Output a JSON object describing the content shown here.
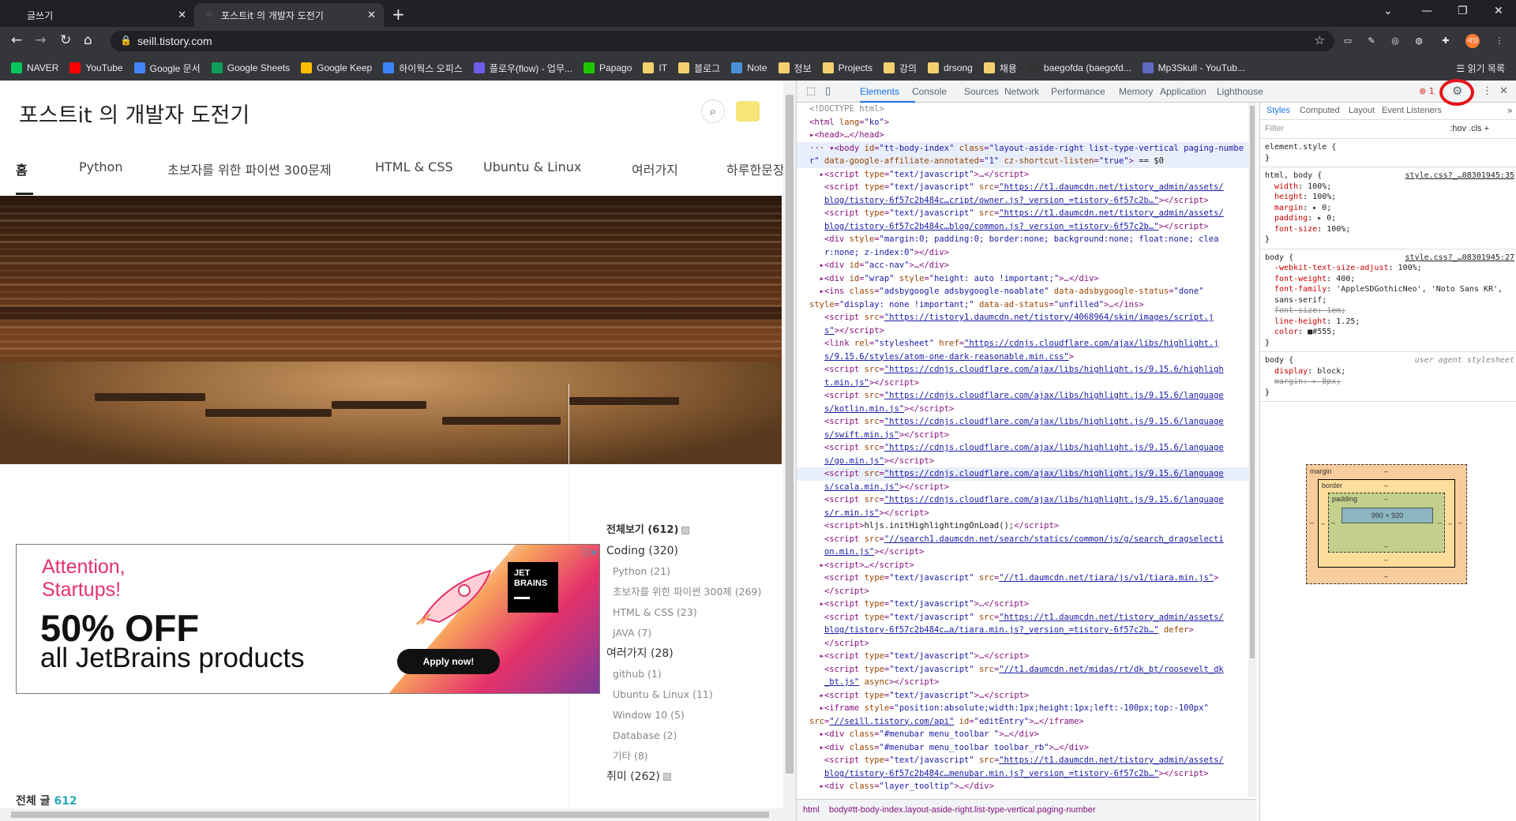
{
  "browser": {
    "tabs": [
      {
        "label": "글쓰기",
        "active": false
      },
      {
        "label": "포스트it 의 개발자 도전기",
        "active": true
      }
    ],
    "url": "seill.tistory.com",
    "profile_badge": "세일",
    "bookmarks": [
      {
        "label": "NAVER",
        "color": "#03c75a",
        "icon": "naver-icon"
      },
      {
        "label": "YouTube",
        "color": "#ff0000",
        "icon": "youtube-icon"
      },
      {
        "label": "Google 문서",
        "color": "#4285f4",
        "icon": "docs-icon"
      },
      {
        "label": "Google Sheets",
        "color": "#0f9d58",
        "icon": "sheets-icon"
      },
      {
        "label": "Google Keep",
        "color": "#fbbc04",
        "icon": "keep-icon"
      },
      {
        "label": "하이웍스 오피스",
        "color": "#3b82f6",
        "icon": "hiworks-icon"
      },
      {
        "label": "플로우(flow) - 업무...",
        "color": "#6c5ce7",
        "icon": "flow-icon"
      },
      {
        "label": "Papago",
        "color": "#1ec800",
        "icon": "papago-icon"
      },
      {
        "label": "IT",
        "color": "#f4d06f",
        "icon": "folder-icon"
      },
      {
        "label": "블로그",
        "color": "#f4d06f",
        "icon": "folder-icon"
      },
      {
        "label": "Note",
        "color": "#4a90d9",
        "icon": "note-icon"
      },
      {
        "label": "정보",
        "color": "#f4d06f",
        "icon": "folder-icon"
      },
      {
        "label": "Projects",
        "color": "#f4d06f",
        "icon": "folder-icon"
      },
      {
        "label": "강의",
        "color": "#f4d06f",
        "icon": "folder-icon"
      },
      {
        "label": "drsong",
        "color": "#f4d06f",
        "icon": "folder-icon"
      },
      {
        "label": "채용",
        "color": "#f4d06f",
        "icon": "folder-icon"
      },
      {
        "label": "baegofda (baegofd...",
        "color": "#333333",
        "icon": "github-icon"
      },
      {
        "label": "Mp3Skull - YouTub...",
        "color": "#5c6bc0",
        "icon": "mp3skull-icon"
      }
    ],
    "reading_list": "읽기 목록"
  },
  "blog": {
    "title": "포스트it 의 개발자 도전기",
    "menu": [
      "홈",
      "Python",
      "초보자를 위한 파이썬 300문제",
      "HTML & CSS",
      "Ubuntu & Linux",
      "여러가지",
      "하루한문장"
    ],
    "ad": {
      "line1": "Attention,",
      "line2": "Startups!",
      "headline": "50% OFF",
      "subline": "all JetBrains products",
      "button": "Apply now!",
      "logo_line1": "JET",
      "logo_line2": "BRAINS"
    },
    "categories": [
      {
        "label": "전체보기 (612)",
        "level": "main",
        "new": true
      },
      {
        "label": "Coding (320)",
        "level": "group",
        "new": false
      },
      {
        "label": "Python (21)",
        "level": "sub",
        "new": false
      },
      {
        "label": "초보자를 위한 파이썬 300제 (269)",
        "level": "sub",
        "new": false
      },
      {
        "label": "HTML & CSS (23)",
        "level": "sub",
        "new": false
      },
      {
        "label": "JAVA (7)",
        "level": "sub",
        "new": false
      },
      {
        "label": "여러가지 (28)",
        "level": "group",
        "new": false
      },
      {
        "label": "github (1)",
        "level": "sub",
        "new": false
      },
      {
        "label": "Ubuntu & Linux (11)",
        "level": "sub",
        "new": false
      },
      {
        "label": "Window 10 (5)",
        "level": "sub",
        "new": false
      },
      {
        "label": "Database (2)",
        "level": "sub",
        "new": false
      },
      {
        "label": "기타 (8)",
        "level": "sub",
        "new": false
      },
      {
        "label": "취미 (262)",
        "level": "group",
        "new": true
      }
    ],
    "total_label": "전체 글",
    "total_count": "612"
  },
  "devtools": {
    "tabs": [
      "Elements",
      "Console",
      "Sources",
      "Network",
      "Performance",
      "Memory",
      "Application",
      "Lighthouse"
    ],
    "error_count": "1",
    "breadcrumb_html": "html",
    "breadcrumb_body": "body#tt-body-index.layout-aside-right.list-type-vertical.paging-number",
    "style_tabs": [
      "Styles",
      "Computed",
      "Layout",
      "Event Listeners"
    ],
    "filter_placeholder": "Filter",
    "filter_right": ":hov  .cls  +",
    "box_model": {
      "margin": "margin",
      "border": "border",
      "padding": "padding",
      "content": "990 × 920",
      "dash": "–"
    },
    "dom_lines": [
      {
        "cls": "doc",
        "html": "&lt;!DOCTYPE html&gt;"
      },
      {
        "cls": "",
        "html": "<span class='t'>&lt;html</span> <span class='an'>lang</span>=<span class='av'>\"ko\"</span><span class='t'>&gt;</span>"
      },
      {
        "cls": "",
        "html": "▸<span class='t'>&lt;head&gt;</span>…<span class='t'>&lt;/head&gt;</span>"
      },
      {
        "cls": "sel",
        "html": "··· ▾<span class='t'>&lt;body</span> <span class='an'>id</span>=<span class='av'>\"tt-body-index\"</span> <span class='an'>class</span>=<span class='av'>\"layout-aside-right list-type-vertical paging-numbe</span>"
      },
      {
        "cls": "sel",
        "html": "<span class='av'>r\"</span> <span class='an'>data-google-affiliate-annotated</span>=<span class='av'>\"1\"</span> <span class='an'>cz-shortcut-listen</span>=<span class='av'>\"true\"</span><span class='t'>&gt;</span> <span class='tx'>== $0</span>"
      },
      {
        "cls": "",
        "html": "&nbsp;&nbsp;▸<span class='t'>&lt;script</span> <span class='an'>type</span>=<span class='av'>\"text/javascript\"</span><span class='t'>&gt;</span>…<span class='t'>&lt;/script&gt;</span>"
      },
      {
        "cls": "",
        "html": "&nbsp;&nbsp;&nbsp;<span class='t'>&lt;script</span> <span class='an'>type</span>=<span class='av'>\"text/javascript\"</span> <span class='an'>src</span>=<span class='lnk'>\"https://t1.daumcdn.net/tistory_admin/assets/</span>"
      },
      {
        "cls": "",
        "html": "&nbsp;&nbsp;&nbsp;<span class='lnk'>blog/tistory-6f57c2b484c…cript/owner.js?_version_=tistory-6f57c2b…\"</span><span class='t'>&gt;&lt;/script&gt;</span>"
      },
      {
        "cls": "",
        "html": "&nbsp;&nbsp;&nbsp;<span class='t'>&lt;script</span> <span class='an'>type</span>=<span class='av'>\"text/javascript\"</span> <span class='an'>src</span>=<span class='lnk'>\"https://t1.daumcdn.net/tistory_admin/assets/</span>"
      },
      {
        "cls": "",
        "html": "&nbsp;&nbsp;&nbsp;<span class='lnk'>blog/tistory-6f57c2b484c…blog/common.js?_version_=tistory-6f57c2b…\"</span><span class='t'>&gt;&lt;/script&gt;</span>"
      },
      {
        "cls": "",
        "html": "&nbsp;&nbsp;&nbsp;<span class='t'>&lt;div</span> <span class='an'>style</span>=<span class='av'>\"margin:0; padding:0; border:none; background:none; float:none; clea</span>"
      },
      {
        "cls": "",
        "html": "&nbsp;&nbsp;&nbsp;<span class='av'>r:none; z-index:0\"</span><span class='t'>&gt;&lt;/div&gt;</span>"
      },
      {
        "cls": "",
        "html": "&nbsp;&nbsp;▸<span class='t'>&lt;div</span> <span class='an'>id</span>=<span class='av'>\"acc-nav\"</span><span class='t'>&gt;</span>…<span class='t'>&lt;/div&gt;</span>"
      },
      {
        "cls": "",
        "html": "&nbsp;&nbsp;▸<span class='t'>&lt;div</span> <span class='an'>id</span>=<span class='av'>\"wrap\"</span> <span class='an'>style</span>=<span class='av'>\"height: auto !important;\"</span><span class='t'>&gt;</span>…<span class='t'>&lt;/div&gt;</span>"
      },
      {
        "cls": "",
        "html": "&nbsp;&nbsp;▸<span class='t'>&lt;ins</span> <span class='an'>class</span>=<span class='av'>\"adsbygoogle adsbygoogle-noablate\"</span> <span class='an'>data-adsbygoogle-status</span>=<span class='av'>\"done\"</span>"
      },
      {
        "cls": "",
        "html": "<span class='an'>style</span>=<span class='av'>\"display: none !important;\"</span> <span class='an'>data-ad-status</span>=<span class='av'>\"unfilled\"</span><span class='t'>&gt;</span>…<span class='t'>&lt;/ins&gt;</span>"
      },
      {
        "cls": "",
        "html": "&nbsp;&nbsp;&nbsp;<span class='t'>&lt;script</span> <span class='an'>src</span>=<span class='lnk'>\"https://tistory1.daumcdn.net/tistory/4068964/skin/images/script.j</span>"
      },
      {
        "cls": "",
        "html": "&nbsp;&nbsp;&nbsp;<span class='lnk'>s\"</span><span class='t'>&gt;&lt;/script&gt;</span>"
      },
      {
        "cls": "",
        "html": "&nbsp;&nbsp;&nbsp;<span class='t'>&lt;link</span> <span class='an'>rel</span>=<span class='av'>\"stylesheet\"</span> <span class='an'>href</span>=<span class='lnk'>\"https://cdnjs.cloudflare.com/ajax/libs/highlight.j</span>"
      },
      {
        "cls": "",
        "html": "&nbsp;&nbsp;&nbsp;<span class='lnk'>s/9.15.6/styles/atom-one-dark-reasonable.min.css\"</span><span class='t'>&gt;</span>"
      },
      {
        "cls": "",
        "html": "&nbsp;&nbsp;&nbsp;<span class='t'>&lt;script</span> <span class='an'>src</span>=<span class='lnk'>\"https://cdnjs.cloudflare.com/ajax/libs/highlight.js/9.15.6/highligh</span>"
      },
      {
        "cls": "",
        "html": "&nbsp;&nbsp;&nbsp;<span class='lnk'>t.min.js\"</span><span class='t'>&gt;&lt;/script&gt;</span>"
      },
      {
        "cls": "",
        "html": "&nbsp;&nbsp;&nbsp;<span class='t'>&lt;script</span> <span class='an'>src</span>=<span class='lnk'>\"https://cdnjs.cloudflare.com/ajax/libs/highlight.js/9.15.6/language</span>"
      },
      {
        "cls": "",
        "html": "&nbsp;&nbsp;&nbsp;<span class='lnk'>s/kotlin.min.js\"</span><span class='t'>&gt;&lt;/script&gt;</span>"
      },
      {
        "cls": "",
        "html": "&nbsp;&nbsp;&nbsp;<span class='t'>&lt;script</span> <span class='an'>src</span>=<span class='lnk'>\"https://cdnjs.cloudflare.com/ajax/libs/highlight.js/9.15.6/language</span>"
      },
      {
        "cls": "",
        "html": "&nbsp;&nbsp;&nbsp;<span class='lnk'>s/swift.min.js\"</span><span class='t'>&gt;&lt;/script&gt;</span>"
      },
      {
        "cls": "",
        "html": "&nbsp;&nbsp;&nbsp;<span class='t'>&lt;script</span> <span class='an'>src</span>=<span class='lnk'>\"https://cdnjs.cloudflare.com/ajax/libs/highlight.js/9.15.6/language</span>"
      },
      {
        "cls": "",
        "html": "&nbsp;&nbsp;&nbsp;<span class='lnk'>s/go.min.js\"</span><span class='t'>&gt;&lt;/script&gt;</span>"
      },
      {
        "cls": "sel",
        "html": "&nbsp;&nbsp;&nbsp;<span class='t'>&lt;script</span> <span class='an'>src</span>=<span class='lnk'>\"https://cdnjs.cloudflare.com/ajax/libs/highlight.js/9.15.6/language</span>"
      },
      {
        "cls": "",
        "html": "&nbsp;&nbsp;&nbsp;<span class='lnk'>s/scala.min.js\"</span><span class='t'>&gt;&lt;/script&gt;</span>"
      },
      {
        "cls": "",
        "html": "&nbsp;&nbsp;&nbsp;<span class='t'>&lt;script</span> <span class='an'>src</span>=<span class='lnk'>\"https://cdnjs.cloudflare.com/ajax/libs/highlight.js/9.15.6/language</span>"
      },
      {
        "cls": "",
        "html": "&nbsp;&nbsp;&nbsp;<span class='lnk'>s/r.min.js\"</span><span class='t'>&gt;&lt;/script&gt;</span>"
      },
      {
        "cls": "",
        "html": "&nbsp;&nbsp;&nbsp;<span class='t'>&lt;script&gt;</span><span class='tx'>hljs.initHighlightingOnLoad();</span><span class='t'>&lt;/script&gt;</span>"
      },
      {
        "cls": "",
        "html": "&nbsp;&nbsp;&nbsp;<span class='t'>&lt;script</span> <span class='an'>src</span>=<span class='lnk'>\"//search1.daumcdn.net/search/statics/common/js/g/search_dragselecti</span>"
      },
      {
        "cls": "",
        "html": "&nbsp;&nbsp;&nbsp;<span class='lnk'>on.min.js\"</span><span class='t'>&gt;&lt;/script&gt;</span>"
      },
      {
        "cls": "",
        "html": "&nbsp;&nbsp;▸<span class='t'>&lt;script&gt;</span>…<span class='t'>&lt;/script&gt;</span>"
      },
      {
        "cls": "",
        "html": "&nbsp;&nbsp;&nbsp;<span class='t'>&lt;script</span> <span class='an'>type</span>=<span class='av'>\"text/javascript\"</span> <span class='an'>src</span>=<span class='lnk'>\"//t1.daumcdn.net/tiara/js/v1/tiara.min.js\"</span><span class='t'>&gt;</span>"
      },
      {
        "cls": "",
        "html": "&nbsp;&nbsp;&nbsp;<span class='t'>&lt;/script&gt;</span>"
      },
      {
        "cls": "",
        "html": "&nbsp;&nbsp;▸<span class='t'>&lt;script</span> <span class='an'>type</span>=<span class='av'>\"text/javascript\"</span><span class='t'>&gt;</span>…<span class='t'>&lt;/script&gt;</span>"
      },
      {
        "cls": "",
        "html": "&nbsp;&nbsp;&nbsp;<span class='t'>&lt;script</span> <span class='an'>type</span>=<span class='av'>\"text/javascript\"</span> <span class='an'>src</span>=<span class='lnk'>\"https://t1.daumcdn.net/tistory_admin/assets/</span>"
      },
      {
        "cls": "",
        "html": "&nbsp;&nbsp;&nbsp;<span class='lnk'>blog/tistory-6f57c2b484c…a/tiara.min.js?_version_=tistory-6f57c2b…\"</span> <span class='an'>defer</span><span class='t'>&gt;</span>"
      },
      {
        "cls": "",
        "html": "&nbsp;&nbsp;&nbsp;<span class='t'>&lt;/script&gt;</span>"
      },
      {
        "cls": "",
        "html": "&nbsp;&nbsp;▸<span class='t'>&lt;script</span> <span class='an'>type</span>=<span class='av'>\"text/javascript\"</span><span class='t'>&gt;</span>…<span class='t'>&lt;/script&gt;</span>"
      },
      {
        "cls": "",
        "html": "&nbsp;&nbsp;&nbsp;<span class='t'>&lt;script</span> <span class='an'>type</span>=<span class='av'>\"text/javascript\"</span> <span class='an'>src</span>=<span class='lnk'>\"//t1.daumcdn.net/midas/rt/dk_bt/roosevelt_dk</span>"
      },
      {
        "cls": "",
        "html": "&nbsp;&nbsp;&nbsp;<span class='lnk'>_bt.js\"</span> <span class='an'>async</span><span class='t'>&gt;&lt;/script&gt;</span>"
      },
      {
        "cls": "",
        "html": "&nbsp;&nbsp;▸<span class='t'>&lt;script</span> <span class='an'>type</span>=<span class='av'>\"text/javascript\"</span><span class='t'>&gt;</span>…<span class='t'>&lt;/script&gt;</span>"
      },
      {
        "cls": "",
        "html": "&nbsp;&nbsp;▸<span class='t'>&lt;iframe</span> <span class='an'>style</span>=<span class='av'>\"position:absolute;width:1px;height:1px;left:-100px;top:-100px\"</span>"
      },
      {
        "cls": "",
        "html": "<span class='an'>src</span>=<span class='lnk'>\"//seill.tistory.com/api\"</span> <span class='an'>id</span>=<span class='av'>\"editEntry\"</span><span class='t'>&gt;</span>…<span class='t'>&lt;/iframe&gt;</span>"
      },
      {
        "cls": "",
        "html": "&nbsp;&nbsp;▸<span class='t'>&lt;div</span> <span class='an'>class</span>=<span class='av'>\"#menubar menu_toolbar \"</span><span class='t'>&gt;</span>…<span class='t'>&lt;/div&gt;</span>"
      },
      {
        "cls": "",
        "html": "&nbsp;&nbsp;▸<span class='t'>&lt;div</span> <span class='an'>class</span>=<span class='av'>\"#menubar menu_toolbar  toolbar_rb\"</span><span class='t'>&gt;</span>…<span class='t'>&lt;/div&gt;</span>"
      },
      {
        "cls": "",
        "html": "&nbsp;&nbsp;&nbsp;<span class='t'>&lt;script</span> <span class='an'>type</span>=<span class='av'>\"text/javascript\"</span> <span class='an'>src</span>=<span class='lnk'>\"https://t1.daumcdn.net/tistory_admin/assets/</span>"
      },
      {
        "cls": "",
        "html": "&nbsp;&nbsp;&nbsp;<span class='lnk'>blog/tistory-6f57c2b484c…menubar.min.js?_version_=tistory-6f57c2b…\"</span><span class='t'>&gt;&lt;/script&gt;</span>"
      },
      {
        "cls": "",
        "html": "&nbsp;&nbsp;▸<span class='t'>&lt;div</span> <span class='an'>class</span>=<span class='av'>\"layer_tooltip\"</span><span class='t'>&gt;</span>…<span class='t'>&lt;/div&gt;</span>"
      }
    ],
    "style_rules": [
      {
        "selector": "element.style {",
        "source": "",
        "ua": false,
        "props": []
      },
      {
        "selector": "html, body {",
        "source": "style.css?_…08301945:35",
        "ua": false,
        "props": [
          {
            "name": "width",
            "value": "100%;",
            "strike": false
          },
          {
            "name": "height",
            "value": "100%;",
            "strike": false
          },
          {
            "name": "margin",
            "value": "▸ 0;",
            "strike": false
          },
          {
            "name": "padding",
            "value": "▸ 0;",
            "strike": false
          },
          {
            "name": "font-size",
            "value": "100%;",
            "strike": false
          }
        ]
      },
      {
        "selector": "body {",
        "source": "style.css?_…08301945:27",
        "ua": false,
        "props": [
          {
            "name": "-webkit-text-size-adjust",
            "value": "100%;",
            "strike": false
          },
          {
            "name": "font-weight",
            "value": "400;",
            "strike": false
          },
          {
            "name": "font-family",
            "value": "'AppleSDGothicNeo', 'Noto Sans KR', sans-serif;",
            "strike": false
          },
          {
            "name": "font-size",
            "value": "1em;",
            "strike": true
          },
          {
            "name": "line-height",
            "value": "1.25;",
            "strike": false
          },
          {
            "name": "color",
            "value": "■#555;",
            "strike": false
          }
        ]
      },
      {
        "selector": "body {",
        "source": "user agent stylesheet",
        "ua": true,
        "props": [
          {
            "name": "display",
            "value": "block;",
            "strike": false
          },
          {
            "name": "margin",
            "value": "▸ 8px;",
            "strike": true
          }
        ]
      }
    ]
  }
}
